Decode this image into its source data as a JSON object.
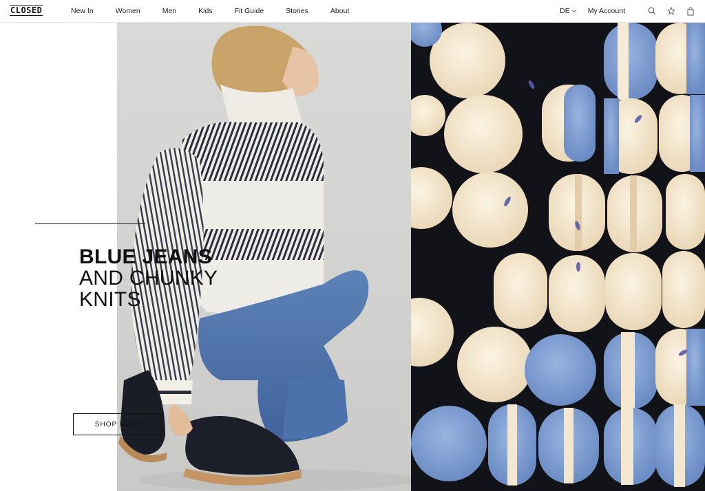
{
  "brand": {
    "logo_text": "CLOSED"
  },
  "nav": {
    "items": [
      {
        "label": "New In"
      },
      {
        "label": "Women"
      },
      {
        "label": "Men"
      },
      {
        "label": "Kids"
      },
      {
        "label": "Fit Guide"
      },
      {
        "label": "Stories"
      },
      {
        "label": "About"
      }
    ]
  },
  "header": {
    "language": "DE",
    "account_label": "My Account",
    "icons": [
      "search-icon",
      "star-icon",
      "bag-icon"
    ]
  },
  "hero": {
    "headline_line1": "BLUE JEANS",
    "headline_line2": "AND CHUNKY",
    "headline_line3": "KNITS",
    "cta_label": "SHOP NOW"
  },
  "colors": {
    "text": "#111111",
    "photo_bg": "#d5d5d3",
    "macaron_bg": "#121318",
    "macaron_cream": "#f3e6cf",
    "macaron_blue": "#7f9fd0"
  }
}
